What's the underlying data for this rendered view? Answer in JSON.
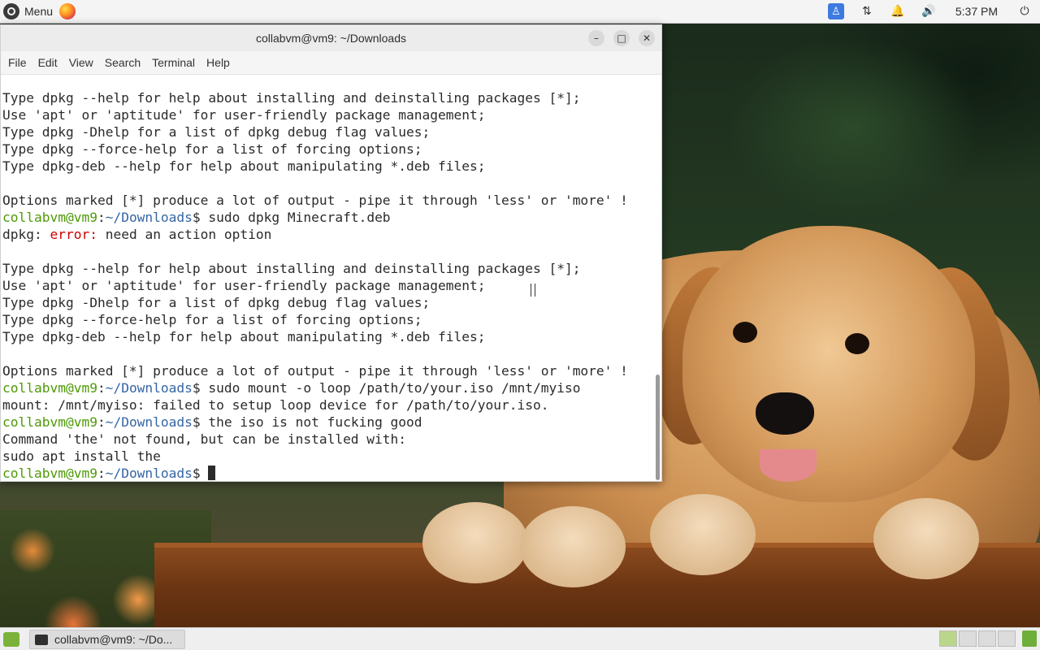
{
  "top_panel": {
    "menu_label": "Menu",
    "clock": "5:37 PM"
  },
  "window": {
    "title": "collabvm@vm9: ~/Downloads",
    "menu": [
      "File",
      "Edit",
      "View",
      "Search",
      "Terminal",
      "Help"
    ]
  },
  "terminal": {
    "prompt_user": "collabvm@vm9",
    "prompt_sep": ":",
    "prompt_path": "~/Downloads",
    "prompt_end": "$",
    "lines": [
      {
        "type": "text",
        "text": "Type dpkg --help for help about installing and deinstalling packages [*];"
      },
      {
        "type": "text",
        "text": "Use 'apt' or 'aptitude' for user-friendly package management;"
      },
      {
        "type": "text",
        "text": "Type dpkg -Dhelp for a list of dpkg debug flag values;"
      },
      {
        "type": "text",
        "text": "Type dpkg --force-help for a list of forcing options;"
      },
      {
        "type": "text",
        "text": "Type dpkg-deb --help for help about manipulating *.deb files;"
      },
      {
        "type": "text",
        "text": ""
      },
      {
        "type": "text",
        "text": "Options marked [*] produce a lot of output - pipe it through 'less' or 'more' !"
      },
      {
        "type": "prompt",
        "cmd": "sudo dpkg Minecraft.deb"
      },
      {
        "type": "error",
        "prefix": "dpkg: ",
        "err": "error:",
        "rest": " need an action option"
      },
      {
        "type": "text",
        "text": ""
      },
      {
        "type": "text",
        "text": "Type dpkg --help for help about installing and deinstalling packages [*];"
      },
      {
        "type": "text",
        "text": "Use 'apt' or 'aptitude' for user-friendly package management;"
      },
      {
        "type": "text",
        "text": "Type dpkg -Dhelp for a list of dpkg debug flag values;"
      },
      {
        "type": "text",
        "text": "Type dpkg --force-help for a list of forcing options;"
      },
      {
        "type": "text",
        "text": "Type dpkg-deb --help for help about manipulating *.deb files;"
      },
      {
        "type": "text",
        "text": ""
      },
      {
        "type": "text",
        "text": "Options marked [*] produce a lot of output - pipe it through 'less' or 'more' !"
      },
      {
        "type": "prompt",
        "cmd": "sudo mount -o loop /path/to/your.iso /mnt/myiso"
      },
      {
        "type": "text",
        "text": "mount: /mnt/myiso: failed to setup loop device for /path/to/your.iso."
      },
      {
        "type": "prompt",
        "cmd": "the iso is not fucking good"
      },
      {
        "type": "text",
        "text": "Command 'the' not found, but can be installed with:"
      },
      {
        "type": "text",
        "text": "sudo apt install the"
      },
      {
        "type": "prompt_active",
        "cmd": ""
      }
    ]
  },
  "taskbar": {
    "task_label": "collabvm@vm9: ~/Do..."
  }
}
